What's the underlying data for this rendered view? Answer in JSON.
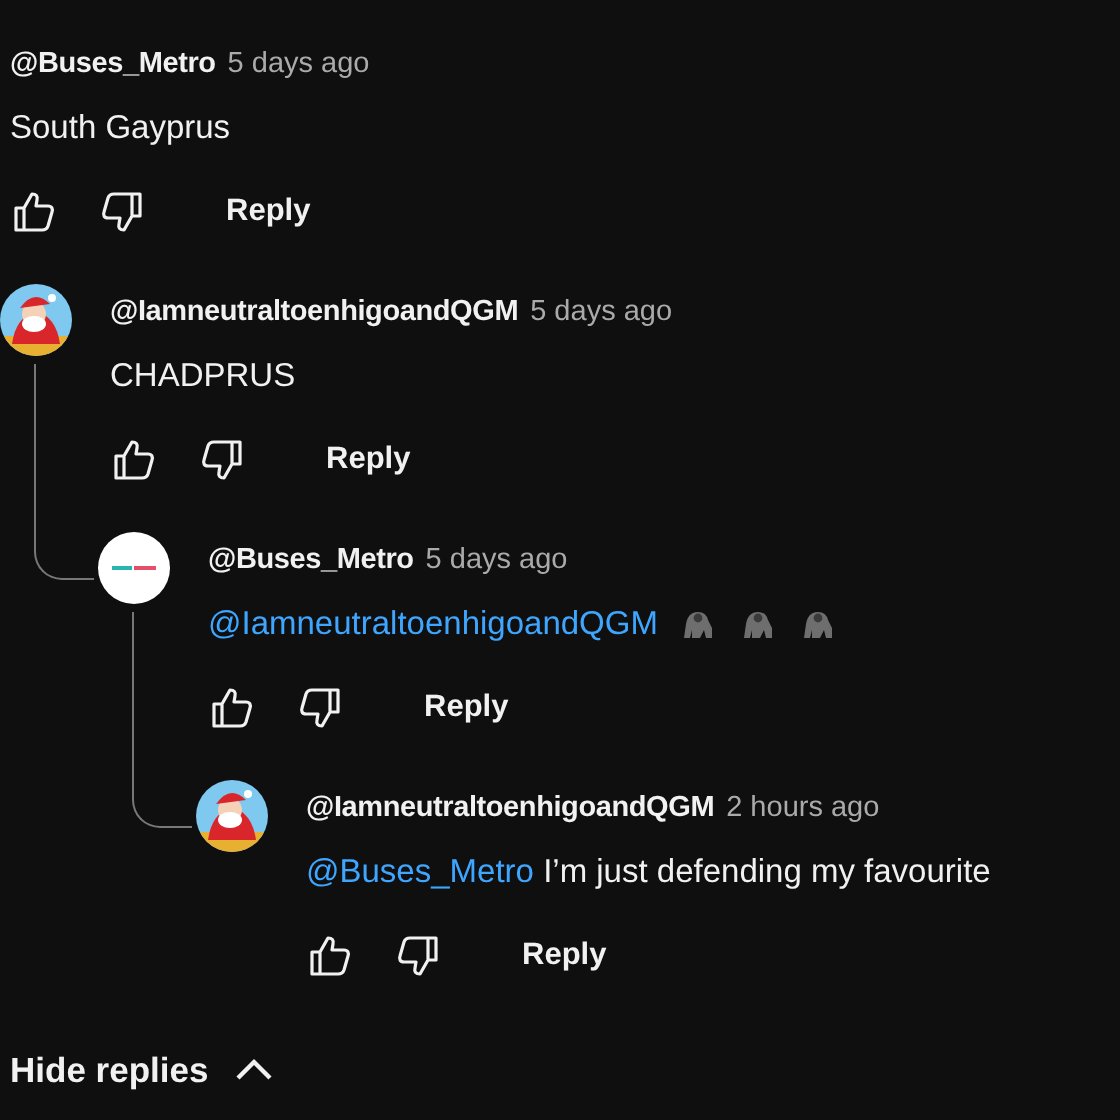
{
  "comment": {
    "author": "@Buses_Metro",
    "time": "5 days ago",
    "text": "South Gayprus",
    "actions": {
      "reply": "Reply"
    },
    "children": [
      {
        "author": "@IamneutraltoenhigoandQGM",
        "time": "5 days ago",
        "avatar": {
          "kind": "santa"
        },
        "text": "CHADPRUS",
        "actions": {
          "reply": "Reply"
        },
        "children": [
          {
            "author": "@Buses_Metro",
            "time": "5 days ago",
            "avatar": {
              "kind": "logo"
            },
            "mention": "@IamneutraltoenhigoandQGM",
            "reactions": [
              {
                "kind": "gorilla"
              },
              {
                "kind": "gorilla"
              },
              {
                "kind": "gorilla"
              }
            ],
            "actions": {
              "reply": "Reply"
            },
            "children": [
              {
                "author": "@IamneutraltoenhigoandQGM",
                "time": "2 hours ago",
                "avatar": {
                  "kind": "santa"
                },
                "mention": "@Buses_Metro",
                "text": "I’m just defending my favourite",
                "actions": {
                  "reply": "Reply"
                }
              }
            ]
          }
        ]
      }
    ]
  },
  "hide_replies": {
    "label": "Hide replies",
    "expanded": true
  }
}
